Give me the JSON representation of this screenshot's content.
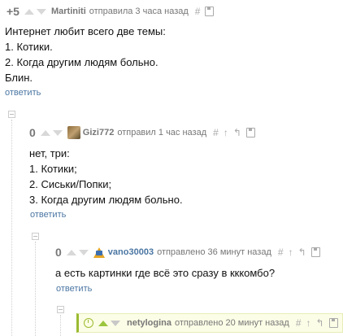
{
  "comments": [
    {
      "rating": "+5",
      "user": "Martiniti",
      "sent": "отправила 3 часа назад",
      "tools": [
        "#",
        "save"
      ],
      "lines": [
        "Интернет любит всего две темы:",
        "1. Котики.",
        "2. Когда другим людям больно.",
        "Блин."
      ],
      "reply": "ответить"
    },
    {
      "rating": "0",
      "user": "Gizi772",
      "sent": "отправил 1 час назад",
      "tools": [
        "#",
        "↑",
        "↰",
        "save"
      ],
      "lines": [
        "нет, три:",
        "1. Котики;",
        "2. Сиськи/Попки;",
        "3. Когда другим людям больно."
      ],
      "reply": "ответить"
    },
    {
      "rating": "0",
      "user": "vano30003",
      "sent": "отправлено 36 минут назад",
      "tools": [
        "#",
        "↑",
        "↰",
        "save"
      ],
      "lines": [
        "а есть картинки где всё это сразу в кккомбо?"
      ],
      "reply": "ответить"
    },
    {
      "rating": "",
      "user": "netylogina",
      "sent": "отправлено 20 минут назад",
      "tools": [
        "#",
        "↑",
        "↰",
        "save"
      ],
      "lines": [],
      "reply": ""
    }
  ],
  "colors": {
    "link": "#4b76a3",
    "highlight_border": "#9bbb30",
    "vote_up_active": "#9bc53d"
  }
}
